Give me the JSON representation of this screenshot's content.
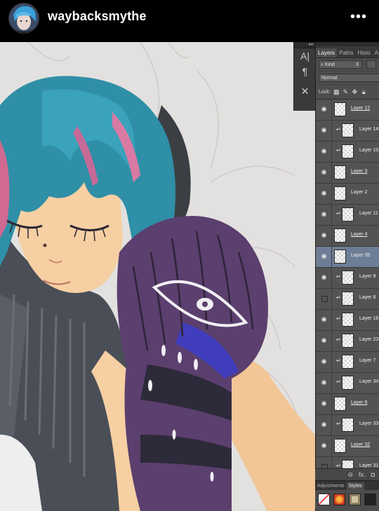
{
  "instagram": {
    "username": "waybacksmythe",
    "more_glyph": "•••"
  },
  "tools": [
    "A|",
    "¶",
    "✕"
  ],
  "panel": {
    "tabs": [
      "Layers",
      "Paths",
      "Histo",
      "A"
    ],
    "kind_label": "Kind",
    "blend_mode": "Normal",
    "lock_label": "Lock:",
    "footer_icons": [
      "link-icon",
      "fx-icon",
      "mask-icon"
    ],
    "footer_fx": "fx.",
    "bottom_tabs": [
      "Adjustments",
      "Styles"
    ]
  },
  "layers": [
    {
      "name": "Layer 12",
      "visible": true,
      "clipped": false,
      "underline": true,
      "selected": false
    },
    {
      "name": "Layer 14",
      "visible": true,
      "clipped": true,
      "underline": false,
      "selected": false
    },
    {
      "name": "Layer 10",
      "visible": true,
      "clipped": true,
      "underline": false,
      "selected": false
    },
    {
      "name": "Layer 3",
      "visible": true,
      "clipped": false,
      "underline": true,
      "selected": false
    },
    {
      "name": "Layer 2",
      "visible": true,
      "clipped": false,
      "underline": false,
      "selected": false
    },
    {
      "name": "Layer 11",
      "visible": true,
      "clipped": true,
      "underline": false,
      "selected": false
    },
    {
      "name": "Layer 4",
      "visible": true,
      "clipped": false,
      "underline": true,
      "selected": false
    },
    {
      "name": "Layer 35",
      "visible": true,
      "clipped": false,
      "underline": false,
      "selected": true
    },
    {
      "name": "Layer 9",
      "visible": true,
      "clipped": true,
      "underline": false,
      "selected": false
    },
    {
      "name": "Layer 8",
      "visible": false,
      "clipped": true,
      "underline": false,
      "selected": false
    },
    {
      "name": "Layer 16",
      "visible": true,
      "clipped": true,
      "underline": false,
      "selected": false
    },
    {
      "name": "Layer 23",
      "visible": true,
      "clipped": true,
      "underline": false,
      "selected": false
    },
    {
      "name": "Layer 7",
      "visible": true,
      "clipped": true,
      "underline": false,
      "selected": false
    },
    {
      "name": "Layer 34",
      "visible": true,
      "clipped": true,
      "underline": false,
      "selected": false
    },
    {
      "name": "Layer 6",
      "visible": true,
      "clipped": false,
      "underline": true,
      "selected": false
    },
    {
      "name": "Layer 33",
      "visible": true,
      "clipped": true,
      "underline": false,
      "selected": false
    },
    {
      "name": "Layer 32",
      "visible": true,
      "clipped": false,
      "underline": true,
      "selected": false
    },
    {
      "name": "Layer 31",
      "visible": false,
      "clipped": true,
      "underline": false,
      "selected": false
    }
  ],
  "colors": {
    "hair": "#2f8fa6",
    "skin": "#f6cfa3",
    "sweater": "#4a4e56",
    "mitten": "#5b3f6e",
    "canvas": "#e3e1df",
    "selected_layer": "#6d7d96"
  }
}
